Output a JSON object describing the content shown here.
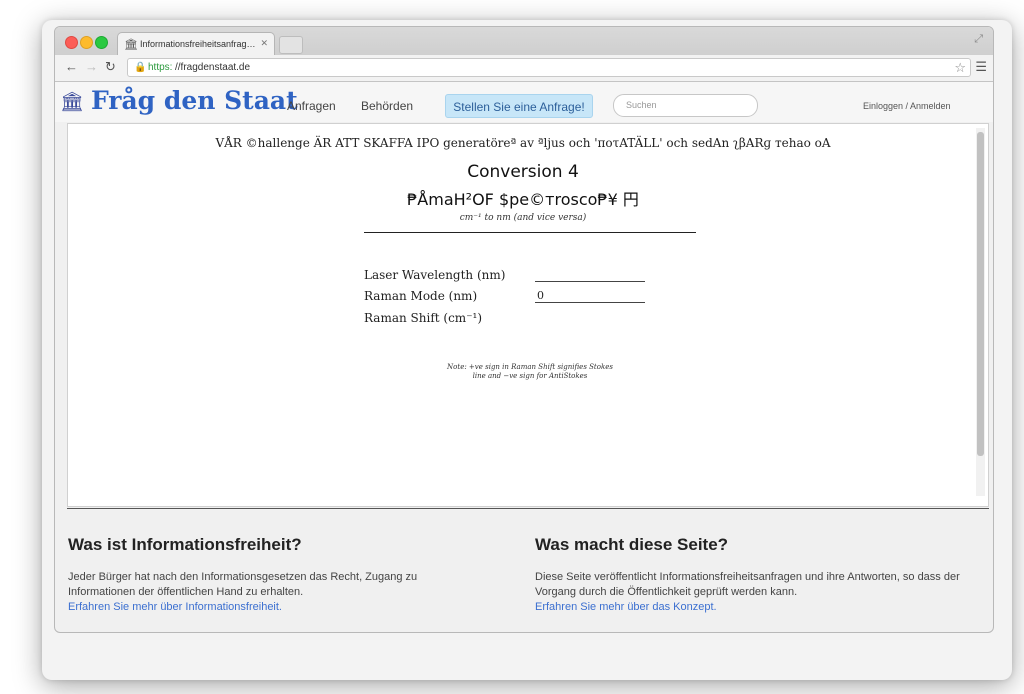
{
  "browser": {
    "tab_title": "Informationsfreiheitsanfrag…",
    "url_scheme": "https:",
    "url_rest": "//fragdenstaat.de"
  },
  "site": {
    "logo": "Fråg den Staat",
    "nav": [
      "Anfragen",
      "Behörden"
    ],
    "cta": "Stellen Sie eine Anfrage!",
    "search_placeholder": "Suchen",
    "login": "Einloggen / Anmelden"
  },
  "embedded": {
    "marquee": "VÅR ©hallenge ÄR ATT SKAFFA IPO generatöreª av ªljus och 'ποτATÄLL' och sedAn ʅβARɡ тehaо оA",
    "heading1": "Conversion 4",
    "heading2": "₱ÅmaH²OF $pe©тrosco₱¥ 円",
    "subtitle": "cm⁻¹ to nm (and vice versa)",
    "fields": [
      {
        "label": "Laser Wavelength (nm)",
        "value": ""
      },
      {
        "label": "Raman Mode (nm)",
        "value": "0"
      },
      {
        "label": "Raman Shift (cm⁻¹)",
        "value": ""
      }
    ],
    "note_line1": "Note: +ve sign in Raman Shift signifies Stokes",
    "note_line2": "line and −ve sign for AntiStokes"
  },
  "info": [
    {
      "title": "Was ist Informationsfreiheit?",
      "text": "Jeder Bürger hat nach den Informationsgesetzen das Recht, Zugang zu Informationen der öffentlichen Hand zu erhalten.",
      "link": "Erfahren Sie mehr über Informationsfreiheit."
    },
    {
      "title": "Was macht diese Seite?",
      "text": "Diese Seite veröffentlicht Informationsfreiheitsanfragen und ihre Antworten, so dass der Vorgang durch die Öffentlichkeit geprüft werden kann.",
      "link": "Erfahren Sie mehr über das Konzept."
    }
  ]
}
